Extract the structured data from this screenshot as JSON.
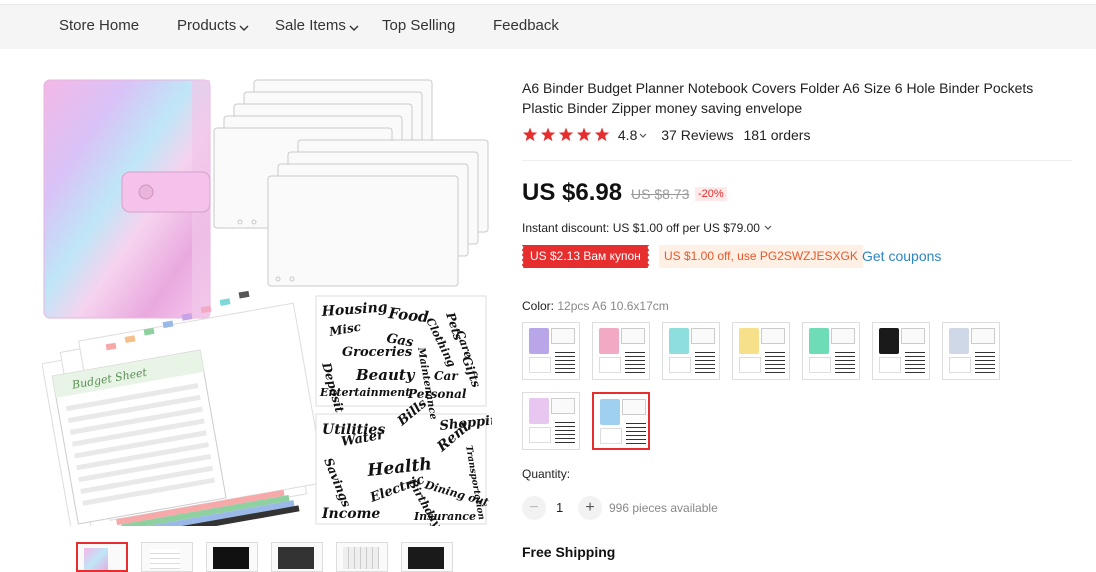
{
  "nav": {
    "items": [
      {
        "label": "Store Home",
        "dropdown": false
      },
      {
        "label": "Products",
        "dropdown": true
      },
      {
        "label": "Sale Items",
        "dropdown": true
      },
      {
        "label": "Top Selling",
        "dropdown": false
      },
      {
        "label": "Feedback",
        "dropdown": false
      }
    ]
  },
  "gallery": {
    "sticker_words_top": [
      "Housing",
      "Food",
      "Pets",
      "Care",
      "Clothing",
      "Misc",
      "Gas",
      "Groceries",
      "Maintenance",
      "Gifts",
      "Deposit",
      "Beauty",
      "Car",
      "Entertainment",
      "Personal"
    ],
    "sticker_words_bottom": [
      "Utilities",
      "Bills",
      "Shopping",
      "Water",
      "Savings",
      "Health",
      "Rent",
      "Transportation",
      "Birthday",
      "Dining out",
      "Electric",
      "Income",
      "Insurance"
    ],
    "sheet_title": "Budget Sheet",
    "thumbnail_count": 6,
    "active_thumbnail": 0
  },
  "product": {
    "title": "A6 Binder Budget Planner Notebook Covers Folder A6 Size 6 Hole Binder Pockets Plastic Binder Zipper money saving envelope",
    "rating": "4.8",
    "star_count": 5,
    "reviews": "37 Reviews",
    "orders": "181 orders",
    "price": "US $6.98",
    "old_price": "US $8.73",
    "discount": "-20%",
    "instant_discount": "Instant discount: US $1.00 off per US $79.00",
    "coupon_red": "US $2.13 Вам купон",
    "coupon_orange": "US $1.00 off, use PG2SWZJESXGK",
    "get_coupons": "Get coupons",
    "color_label": "Color:",
    "color_value": "12pcs A6 10.6x17cm",
    "swatches": [
      {
        "name": "purple",
        "color": "#b9a6e8"
      },
      {
        "name": "pink",
        "color": "#f2a9c4"
      },
      {
        "name": "cyan",
        "color": "#8fdede"
      },
      {
        "name": "yellow",
        "color": "#f6e08a"
      },
      {
        "name": "green",
        "color": "#6fdcb8"
      },
      {
        "name": "black",
        "color": "#1a1a1a"
      },
      {
        "name": "holo-silver",
        "color": "#cfd8e6"
      },
      {
        "name": "holo-pink",
        "color": "#e7c6ef"
      },
      {
        "name": "clear-blue",
        "color": "#9fd0f0"
      }
    ],
    "selected_swatch": 8,
    "quantity_label": "Quantity:",
    "quantity": "1",
    "qty_minus": "−",
    "qty_plus": "+",
    "available": "996 pieces available",
    "shipping": "Free Shipping"
  },
  "colors": {
    "accent_red": "#e62e2e",
    "coupon_orange_text": "#e5582b",
    "link_blue": "#2e86c1",
    "star": "#e62e2e"
  }
}
